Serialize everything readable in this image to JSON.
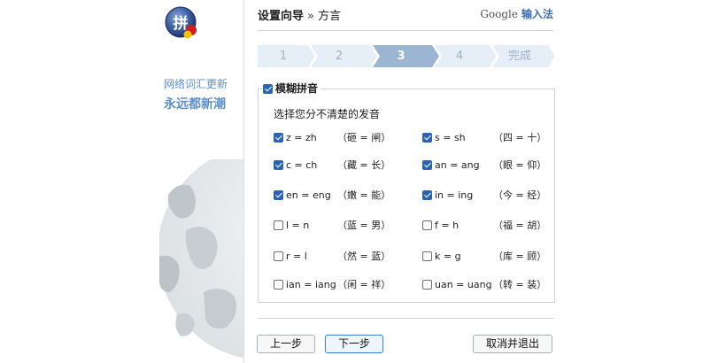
{
  "sidebar": {
    "logo_icon": "ime-logo",
    "tagline_1": "网络词汇更新",
    "tagline_2": "永远都新潮"
  },
  "header": {
    "title": "设置向导",
    "separator": "»",
    "subtitle": "方言",
    "brand": "Google",
    "product": "输入法"
  },
  "steps": {
    "items": [
      "1",
      "2",
      "3",
      "4",
      "完成"
    ],
    "active_index": 2,
    "active_color": "#9bb5d2",
    "inactive_color": "#e6eef8"
  },
  "group": {
    "legend": "模糊拼音",
    "legend_checked": true,
    "description": "选择您分不清楚的发音"
  },
  "options": [
    {
      "label": "z = zh",
      "hint": "（砸 = 闸）",
      "checked": true
    },
    {
      "label": "s = sh",
      "hint": "（四 = 十）",
      "checked": true
    },
    {
      "label": "c = ch",
      "hint": "（藏 = 长）",
      "checked": true
    },
    {
      "label": "an = ang",
      "hint": "（眼 = 仰）",
      "checked": true
    },
    {
      "label": "en = eng",
      "hint": "（嫩 = 能）",
      "checked": true
    },
    {
      "label": "in = ing",
      "hint": "（今 = 经）",
      "checked": true
    },
    {
      "label": "l = n",
      "hint": "（蓝 = 男）",
      "checked": false
    },
    {
      "label": "f = h",
      "hint": "（福 = 胡）",
      "checked": false
    },
    {
      "label": "r = l",
      "hint": "（然 = 蓝）",
      "checked": false
    },
    {
      "label": "k = g",
      "hint": "（库 = 顾）",
      "checked": false
    },
    {
      "label": "ian = iang",
      "hint": "（闲 = 祥）",
      "checked": false
    },
    {
      "label": "uan = uang",
      "hint": "（转 = 装）",
      "checked": false
    }
  ],
  "buttons": {
    "prev": "上一步",
    "next": "下一步",
    "cancel": "取消并退出"
  },
  "colors": {
    "accent": "#2a64b6",
    "tagline": "#5b8fcf"
  }
}
